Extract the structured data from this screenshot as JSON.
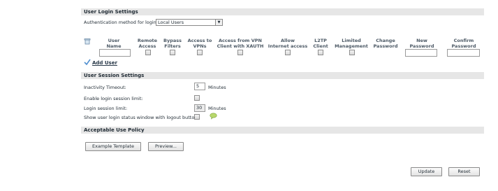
{
  "login_settings": {
    "title": "User Login Settings",
    "auth_label": "Authentication method for login:",
    "auth_value": "Local Users"
  },
  "table": {
    "columns": [
      [
        "User",
        "Name"
      ],
      [
        "Remote",
        "Access"
      ],
      [
        "Bypass",
        "Filters"
      ],
      [
        "Access to",
        "VPNs"
      ],
      [
        "Access from VPN",
        "Client with XAUTH"
      ],
      [
        "Allow",
        "Internet access"
      ],
      [
        "L2TP",
        "Client"
      ],
      [
        "Limited",
        "Management"
      ],
      [
        "Change",
        "Password"
      ],
      [
        "New",
        "Password"
      ],
      [
        "Confirm",
        "Password"
      ]
    ],
    "add_user": "Add User"
  },
  "session_settings": {
    "title": "User Session Settings",
    "inactivity_label": "Inactivity Timeout:",
    "inactivity_value": "5",
    "inactivity_unit": "Minutes",
    "enable_limit_label": "Enable login session limit:",
    "session_limit_label": "Login session limit:",
    "session_limit_value": "30",
    "session_limit_unit": "Minutes",
    "show_status_label": "Show user login status window with logout button:"
  },
  "aup": {
    "title": "Acceptable Use Policy",
    "example_template": "Example Template",
    "preview": "Preview..."
  },
  "footer": {
    "update": "Update",
    "reset": "Reset"
  }
}
